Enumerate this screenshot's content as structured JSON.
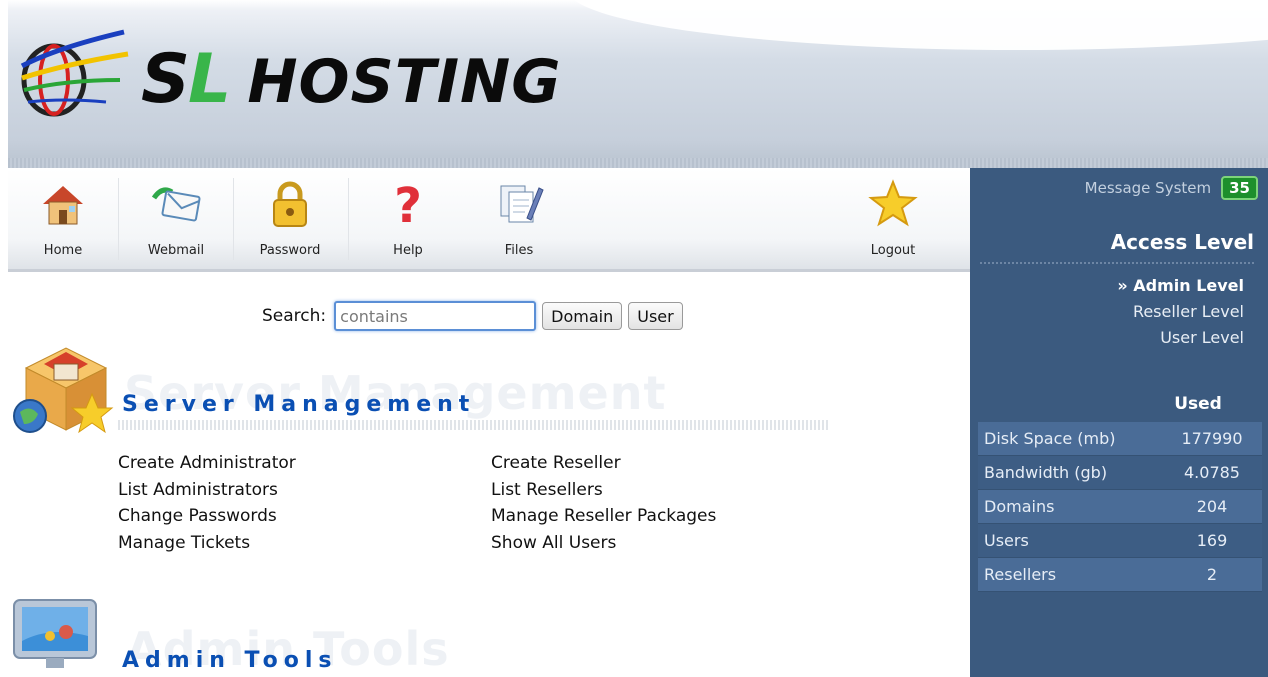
{
  "brand": {
    "logo_text_1": "S",
    "logo_text_2": "L",
    "logo_text_3": "HOSTING"
  },
  "toolbar": {
    "items": [
      {
        "label": "Home",
        "icon": "house-icon"
      },
      {
        "label": "Webmail",
        "icon": "envelope-icon"
      },
      {
        "label": "Password",
        "icon": "padlock-icon"
      },
      {
        "label": "Help",
        "icon": "question-mark-icon"
      },
      {
        "label": "Files",
        "icon": "files-icon"
      }
    ],
    "logout": {
      "label": "Logout",
      "icon": "star-icon"
    }
  },
  "search": {
    "label": "Search:",
    "placeholder": "contains",
    "domain_button": "Domain",
    "user_button": "User"
  },
  "server_management": {
    "ghost": "Server Management",
    "title": "Server Management",
    "left_links": [
      "Create Administrator",
      "List Administrators",
      "Change Passwords",
      "Manage Tickets"
    ],
    "right_links": [
      "Create Reseller",
      "List Resellers",
      "Manage Reseller Packages",
      "Show All Users"
    ]
  },
  "admin_tools": {
    "ghost": "Admin Tools",
    "title": "Admin Tools"
  },
  "sidebar": {
    "message_label": "Message System",
    "message_count": "35",
    "access_title": "Access Level",
    "levels": [
      "» Admin Level",
      "Reseller Level",
      "User Level"
    ],
    "used_header": "Used",
    "stats": [
      {
        "label": "Disk Space (mb)",
        "value": "177990"
      },
      {
        "label": "Bandwidth (gb)",
        "value": "4.0785"
      },
      {
        "label": "Domains",
        "value": "204"
      },
      {
        "label": "Users",
        "value": "169"
      },
      {
        "label": "Resellers",
        "value": "2"
      }
    ]
  },
  "colors": {
    "sidebar_bg": "#3b5a7f",
    "section_title": "#0a4fb3",
    "logo_green": "#39b54a",
    "badge_green": "#1d8f2c"
  }
}
